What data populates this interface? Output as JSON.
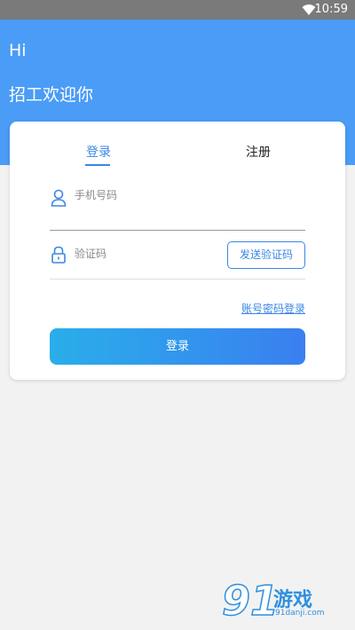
{
  "status_bar": {
    "time": "10:59",
    "wifi_icon": "wifi-icon"
  },
  "header": {
    "greeting": "Hi",
    "welcome": "招工欢迎你",
    "background": "#4a9cf6"
  },
  "card": {
    "tabs": [
      {
        "label": "登录",
        "active": true
      },
      {
        "label": "注册",
        "active": false
      }
    ],
    "phone_field": {
      "placeholder": "手机号码",
      "value": "",
      "icon": "user-icon"
    },
    "code_field": {
      "placeholder": "验证码",
      "value": "",
      "icon": "lock-icon"
    },
    "send_code_label": "发送验证码",
    "account_login_label": "账号密码登录",
    "login_label": "登录"
  },
  "watermark": {
    "logo": "91",
    "game_text": "游戏",
    "domain": "91danji.com"
  },
  "colors": {
    "accent": "#3a86e6",
    "gradient_start": "#2aaeea",
    "gradient_end": "#3a7ff0"
  }
}
